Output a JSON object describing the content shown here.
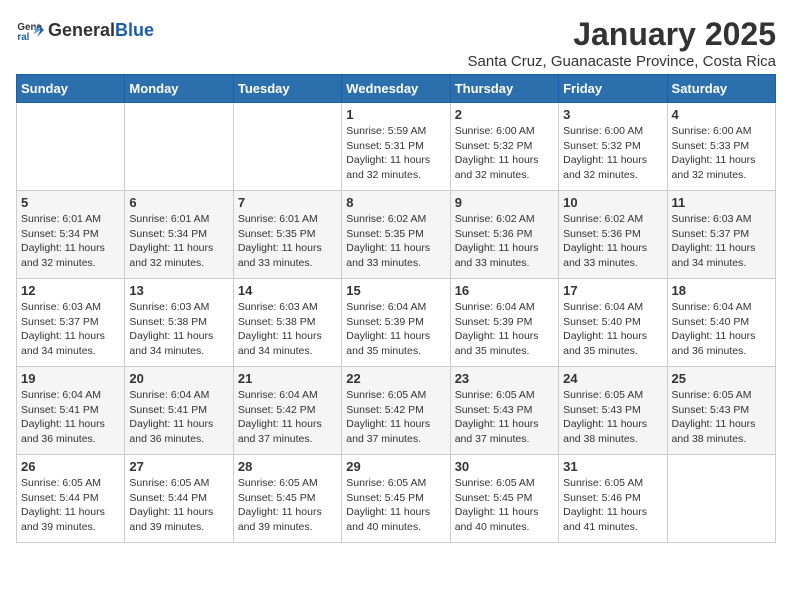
{
  "logo": {
    "text_general": "General",
    "text_blue": "Blue"
  },
  "title": "January 2025",
  "subtitle": "Santa Cruz, Guanacaste Province, Costa Rica",
  "days_of_week": [
    "Sunday",
    "Monday",
    "Tuesday",
    "Wednesday",
    "Thursday",
    "Friday",
    "Saturday"
  ],
  "weeks": [
    [
      {
        "day": "",
        "sunrise": "",
        "sunset": "",
        "daylight": ""
      },
      {
        "day": "",
        "sunrise": "",
        "sunset": "",
        "daylight": ""
      },
      {
        "day": "",
        "sunrise": "",
        "sunset": "",
        "daylight": ""
      },
      {
        "day": "1",
        "sunrise": "Sunrise: 5:59 AM",
        "sunset": "Sunset: 5:31 PM",
        "daylight": "Daylight: 11 hours and 32 minutes."
      },
      {
        "day": "2",
        "sunrise": "Sunrise: 6:00 AM",
        "sunset": "Sunset: 5:32 PM",
        "daylight": "Daylight: 11 hours and 32 minutes."
      },
      {
        "day": "3",
        "sunrise": "Sunrise: 6:00 AM",
        "sunset": "Sunset: 5:32 PM",
        "daylight": "Daylight: 11 hours and 32 minutes."
      },
      {
        "day": "4",
        "sunrise": "Sunrise: 6:00 AM",
        "sunset": "Sunset: 5:33 PM",
        "daylight": "Daylight: 11 hours and 32 minutes."
      }
    ],
    [
      {
        "day": "5",
        "sunrise": "Sunrise: 6:01 AM",
        "sunset": "Sunset: 5:34 PM",
        "daylight": "Daylight: 11 hours and 32 minutes."
      },
      {
        "day": "6",
        "sunrise": "Sunrise: 6:01 AM",
        "sunset": "Sunset: 5:34 PM",
        "daylight": "Daylight: 11 hours and 32 minutes."
      },
      {
        "day": "7",
        "sunrise": "Sunrise: 6:01 AM",
        "sunset": "Sunset: 5:35 PM",
        "daylight": "Daylight: 11 hours and 33 minutes."
      },
      {
        "day": "8",
        "sunrise": "Sunrise: 6:02 AM",
        "sunset": "Sunset: 5:35 PM",
        "daylight": "Daylight: 11 hours and 33 minutes."
      },
      {
        "day": "9",
        "sunrise": "Sunrise: 6:02 AM",
        "sunset": "Sunset: 5:36 PM",
        "daylight": "Daylight: 11 hours and 33 minutes."
      },
      {
        "day": "10",
        "sunrise": "Sunrise: 6:02 AM",
        "sunset": "Sunset: 5:36 PM",
        "daylight": "Daylight: 11 hours and 33 minutes."
      },
      {
        "day": "11",
        "sunrise": "Sunrise: 6:03 AM",
        "sunset": "Sunset: 5:37 PM",
        "daylight": "Daylight: 11 hours and 34 minutes."
      }
    ],
    [
      {
        "day": "12",
        "sunrise": "Sunrise: 6:03 AM",
        "sunset": "Sunset: 5:37 PM",
        "daylight": "Daylight: 11 hours and 34 minutes."
      },
      {
        "day": "13",
        "sunrise": "Sunrise: 6:03 AM",
        "sunset": "Sunset: 5:38 PM",
        "daylight": "Daylight: 11 hours and 34 minutes."
      },
      {
        "day": "14",
        "sunrise": "Sunrise: 6:03 AM",
        "sunset": "Sunset: 5:38 PM",
        "daylight": "Daylight: 11 hours and 34 minutes."
      },
      {
        "day": "15",
        "sunrise": "Sunrise: 6:04 AM",
        "sunset": "Sunset: 5:39 PM",
        "daylight": "Daylight: 11 hours and 35 minutes."
      },
      {
        "day": "16",
        "sunrise": "Sunrise: 6:04 AM",
        "sunset": "Sunset: 5:39 PM",
        "daylight": "Daylight: 11 hours and 35 minutes."
      },
      {
        "day": "17",
        "sunrise": "Sunrise: 6:04 AM",
        "sunset": "Sunset: 5:40 PM",
        "daylight": "Daylight: 11 hours and 35 minutes."
      },
      {
        "day": "18",
        "sunrise": "Sunrise: 6:04 AM",
        "sunset": "Sunset: 5:40 PM",
        "daylight": "Daylight: 11 hours and 36 minutes."
      }
    ],
    [
      {
        "day": "19",
        "sunrise": "Sunrise: 6:04 AM",
        "sunset": "Sunset: 5:41 PM",
        "daylight": "Daylight: 11 hours and 36 minutes."
      },
      {
        "day": "20",
        "sunrise": "Sunrise: 6:04 AM",
        "sunset": "Sunset: 5:41 PM",
        "daylight": "Daylight: 11 hours and 36 minutes."
      },
      {
        "day": "21",
        "sunrise": "Sunrise: 6:04 AM",
        "sunset": "Sunset: 5:42 PM",
        "daylight": "Daylight: 11 hours and 37 minutes."
      },
      {
        "day": "22",
        "sunrise": "Sunrise: 6:05 AM",
        "sunset": "Sunset: 5:42 PM",
        "daylight": "Daylight: 11 hours and 37 minutes."
      },
      {
        "day": "23",
        "sunrise": "Sunrise: 6:05 AM",
        "sunset": "Sunset: 5:43 PM",
        "daylight": "Daylight: 11 hours and 37 minutes."
      },
      {
        "day": "24",
        "sunrise": "Sunrise: 6:05 AM",
        "sunset": "Sunset: 5:43 PM",
        "daylight": "Daylight: 11 hours and 38 minutes."
      },
      {
        "day": "25",
        "sunrise": "Sunrise: 6:05 AM",
        "sunset": "Sunset: 5:43 PM",
        "daylight": "Daylight: 11 hours and 38 minutes."
      }
    ],
    [
      {
        "day": "26",
        "sunrise": "Sunrise: 6:05 AM",
        "sunset": "Sunset: 5:44 PM",
        "daylight": "Daylight: 11 hours and 39 minutes."
      },
      {
        "day": "27",
        "sunrise": "Sunrise: 6:05 AM",
        "sunset": "Sunset: 5:44 PM",
        "daylight": "Daylight: 11 hours and 39 minutes."
      },
      {
        "day": "28",
        "sunrise": "Sunrise: 6:05 AM",
        "sunset": "Sunset: 5:45 PM",
        "daylight": "Daylight: 11 hours and 39 minutes."
      },
      {
        "day": "29",
        "sunrise": "Sunrise: 6:05 AM",
        "sunset": "Sunset: 5:45 PM",
        "daylight": "Daylight: 11 hours and 40 minutes."
      },
      {
        "day": "30",
        "sunrise": "Sunrise: 6:05 AM",
        "sunset": "Sunset: 5:45 PM",
        "daylight": "Daylight: 11 hours and 40 minutes."
      },
      {
        "day": "31",
        "sunrise": "Sunrise: 6:05 AM",
        "sunset": "Sunset: 5:46 PM",
        "daylight": "Daylight: 11 hours and 41 minutes."
      },
      {
        "day": "",
        "sunrise": "",
        "sunset": "",
        "daylight": ""
      }
    ]
  ]
}
